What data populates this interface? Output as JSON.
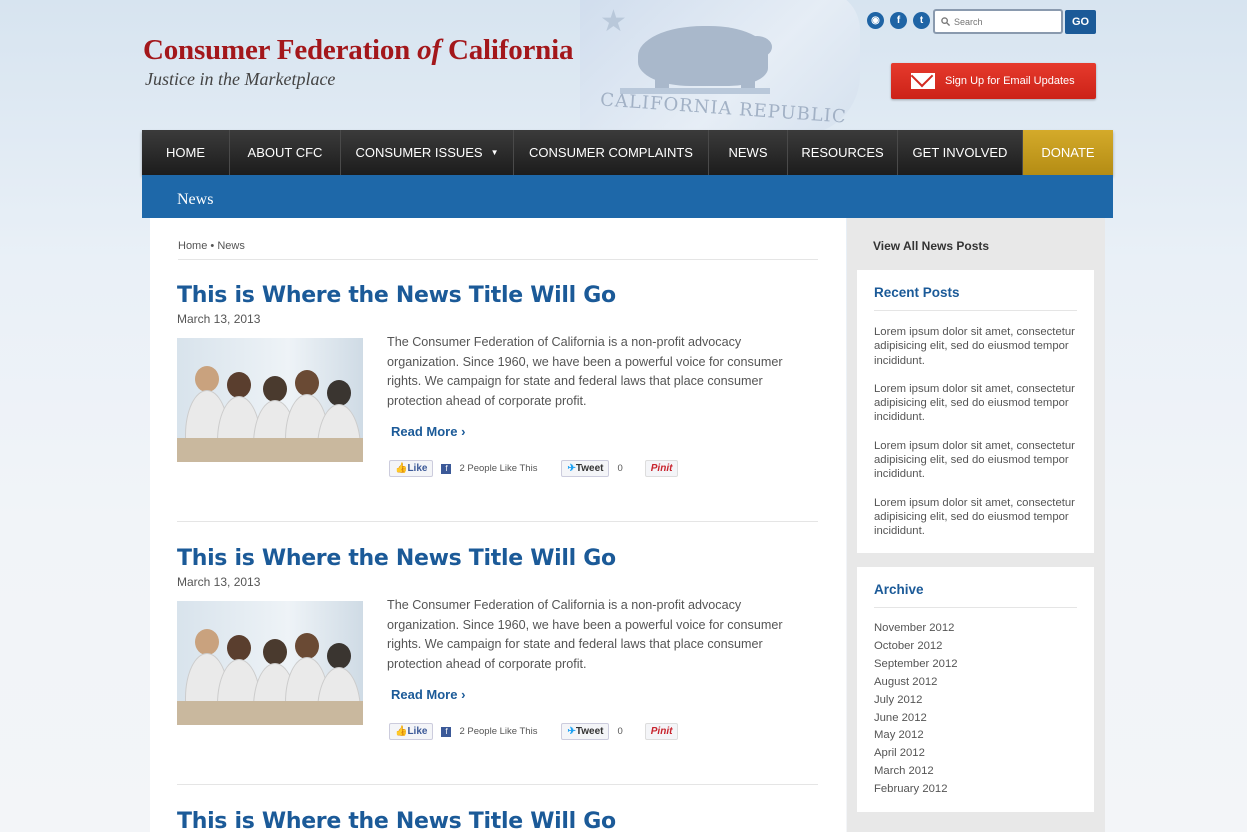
{
  "header": {
    "title_pre": "Consumer Federation ",
    "title_of": "of",
    "title_post": " California",
    "tagline": "Justice in the Marketplace",
    "flag_text": "CALIFORNIA REPUBLIC",
    "search_placeholder": "Search",
    "search_button": "GO",
    "email_button": "Sign Up for Email Updates",
    "social": {
      "rss": "◉",
      "facebook": "f",
      "twitter": "t"
    }
  },
  "nav": [
    {
      "label": "HOME",
      "w": 88
    },
    {
      "label": "ABOUT CFC",
      "w": 111
    },
    {
      "label": "CONSUMER ISSUES",
      "w": 173,
      "caret": "▼"
    },
    {
      "label": "CONSUMER COMPLAINTS",
      "w": 195
    },
    {
      "label": "NEWS",
      "w": 79
    },
    {
      "label": "RESOURCES",
      "w": 110
    },
    {
      "label": "GET INVOLVED",
      "w": 125
    },
    {
      "label": "DONATE",
      "w": 90
    }
  ],
  "page_title": "News",
  "breadcrumb": {
    "home": "Home",
    "sep": " •  ",
    "current": "News"
  },
  "posts": [
    {
      "title": "This is Where the News Title Will Go",
      "date": "March 13, 2013",
      "body": "The Consumer Federation of California is a non-profit advocacy organization. Since 1960, we have been a powerful voice for consumer rights. We campaign for state and federal laws that place consumer protection ahead of corporate profit.",
      "more": "Read More ›",
      "like": "Like",
      "fb_count": "2 People Like This",
      "tweet": "Tweet",
      "tweet_count": "0",
      "pin": "Pinit"
    },
    {
      "title": "This is Where the News Title Will Go",
      "date": "March 13, 2013",
      "body": "The Consumer Federation of California is a non-profit advocacy organization. Since 1960, we have been a powerful voice for consumer rights. We campaign for state and federal laws that place consumer protection ahead of corporate profit.",
      "more": "Read More ›",
      "like": "Like",
      "fb_count": "2 People Like This",
      "tweet": "Tweet",
      "tweet_count": "0",
      "pin": "Pinit"
    },
    {
      "title": "This is Where the News Title Will Go"
    }
  ],
  "sidebar": {
    "view_all": "View All News Posts",
    "recent_title": "Recent Posts",
    "recent": [
      "Lorem ipsum dolor sit amet, consectetur adipisicing elit, sed do eiusmod tempor incididunt.",
      "Lorem ipsum dolor sit amet, consectetur adipisicing elit, sed do eiusmod tempor incididunt.",
      "Lorem ipsum dolor sit amet, consectetur adipisicing elit, sed do eiusmod tempor incididunt.",
      "Lorem ipsum dolor sit amet, consectetur adipisicing elit, sed do eiusmod tempor incididunt."
    ],
    "archive_title": "Archive",
    "archive": [
      "November 2012",
      "October 2012",
      "September 2012",
      "August 2012",
      "July 2012",
      "June 2012",
      "May 2012",
      "April 2012",
      "March 2012",
      "February 2012"
    ]
  }
}
